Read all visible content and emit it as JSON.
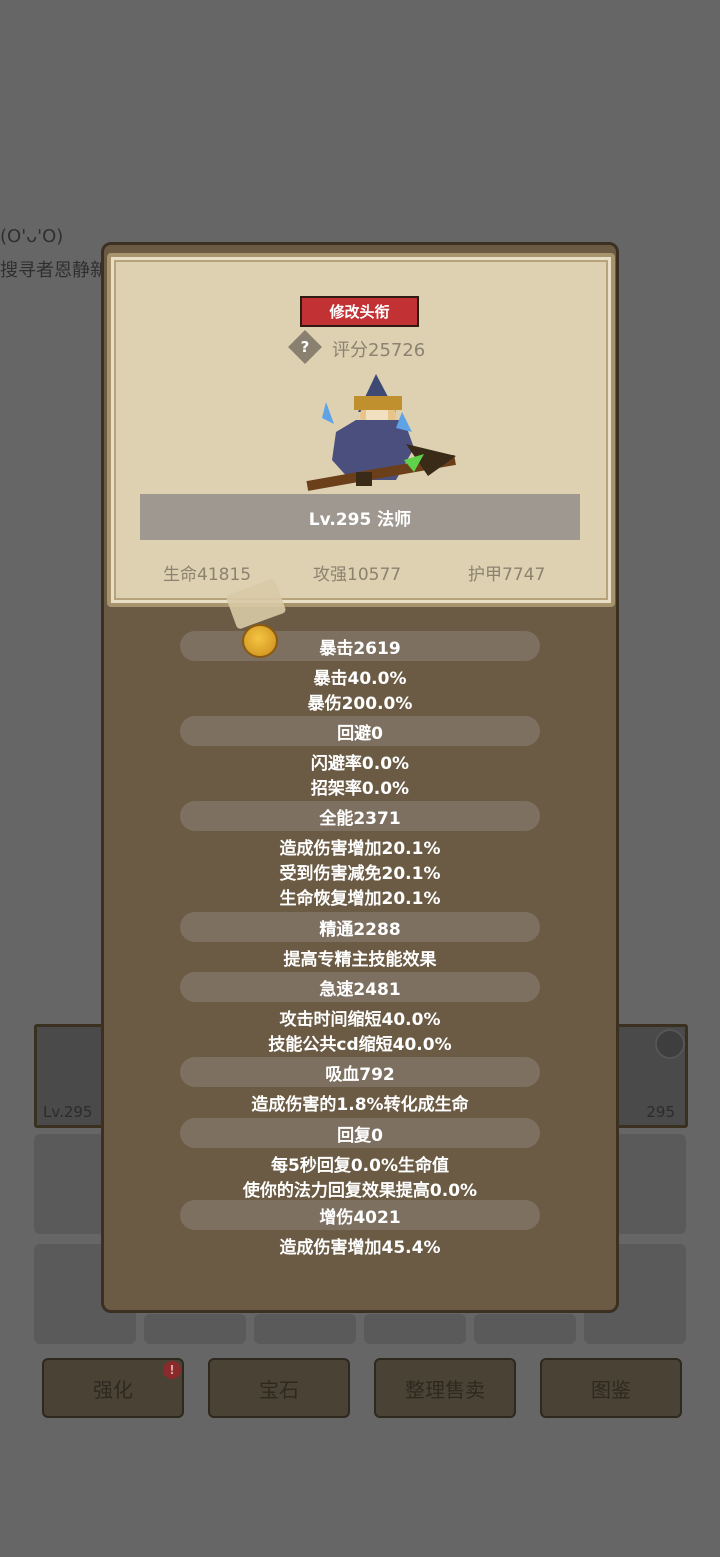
{
  "background": {
    "face_text": "(O'ᴗ'O)",
    "name_text": "搜寻者恩静新",
    "equip_left_level": "Lv.295",
    "equip_right_level": "295",
    "buttons": [
      "强化",
      "宝石",
      "整理售卖",
      "图鉴"
    ],
    "badge": "!"
  },
  "panel": {
    "title_button": "修改头衔",
    "help": "?",
    "score": "评分25726",
    "level_class": "Lv.295 法师",
    "base_stats": [
      "生命41815",
      "攻强10577",
      "护甲7747"
    ],
    "stats": [
      {
        "header": "暴击2619",
        "lines": [
          "暴击40.0%",
          "暴伤200.0%"
        ]
      },
      {
        "header": "回避0",
        "lines": [
          "闪避率0.0%",
          "招架率0.0%"
        ]
      },
      {
        "header": "全能2371",
        "lines": [
          "造成伤害增加20.1%",
          "受到伤害减免20.1%",
          "生命恢复增加20.1%"
        ]
      },
      {
        "header": "精通2288",
        "lines": [
          "提高专精主技能效果"
        ]
      },
      {
        "header": "急速2481",
        "lines": [
          "攻击时间缩短40.0%",
          "技能公共cd缩短40.0%"
        ]
      },
      {
        "header": "吸血792",
        "lines": [
          "造成伤害的1.8%转化成生命"
        ]
      },
      {
        "header": "回复0",
        "lines": [
          "每5秒回复0.0%生命值",
          "使你的法力回复效果提高0.0%"
        ]
      },
      {
        "header": "增伤4021",
        "lines": [
          "造成伤害增加45.4%"
        ]
      }
    ]
  },
  "colors": {
    "title_button": "#c23234",
    "panel": "#6b5b44",
    "parchment": "#ddd1b2"
  }
}
